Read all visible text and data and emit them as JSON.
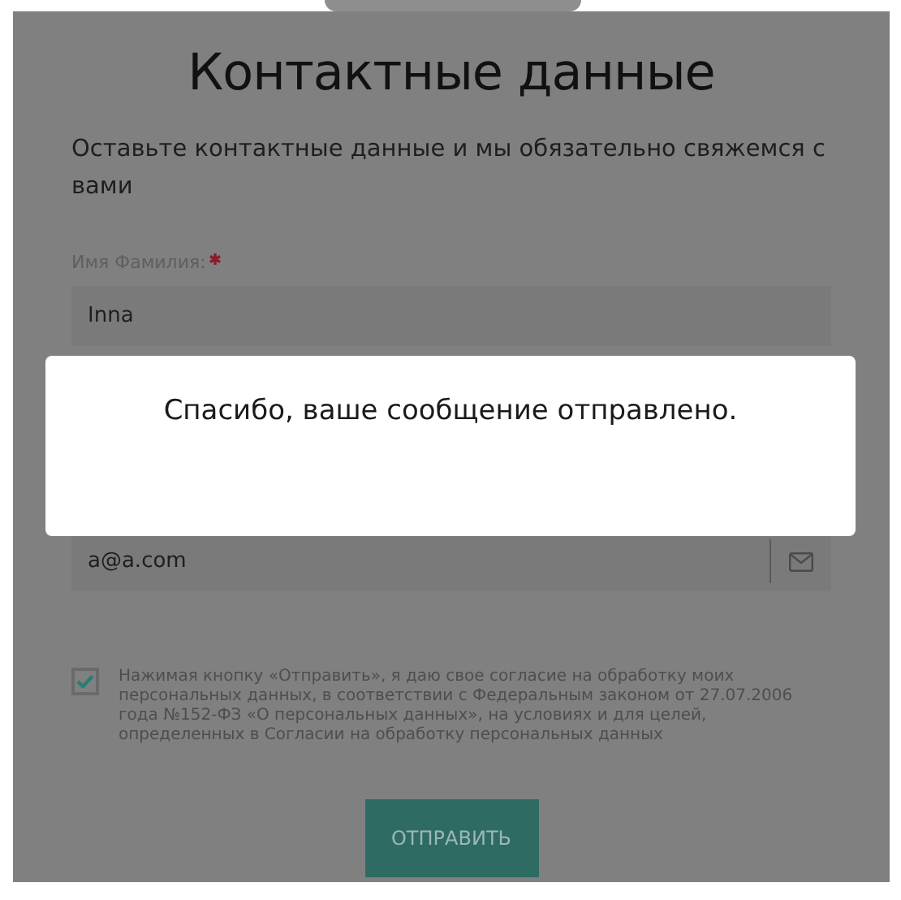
{
  "title": "Контактные данные",
  "subtitle": "Оставьте контактные данные и мы обязательно свяжемся с вами",
  "fields": [
    {
      "label": "Имя Фамилия:",
      "required": true,
      "value": "Inna",
      "kind": "text"
    },
    {
      "value": "a@a.com",
      "kind": "email"
    }
  ],
  "consent": {
    "checked": true,
    "text": "Нажимая кнопку «Отправить», я даю свое согласие на обработку моих персональных данных, в соответствии с Федеральным законом от 27.07.2006 года №152-ФЗ «О персональных данных», на условиях и для целей, определенных в Согласии на обработку персональных данных"
  },
  "submit_button": "ОТПРАВИТЬ",
  "dialog": {
    "message": "Спасибо, ваше сообщение отправлено."
  }
}
